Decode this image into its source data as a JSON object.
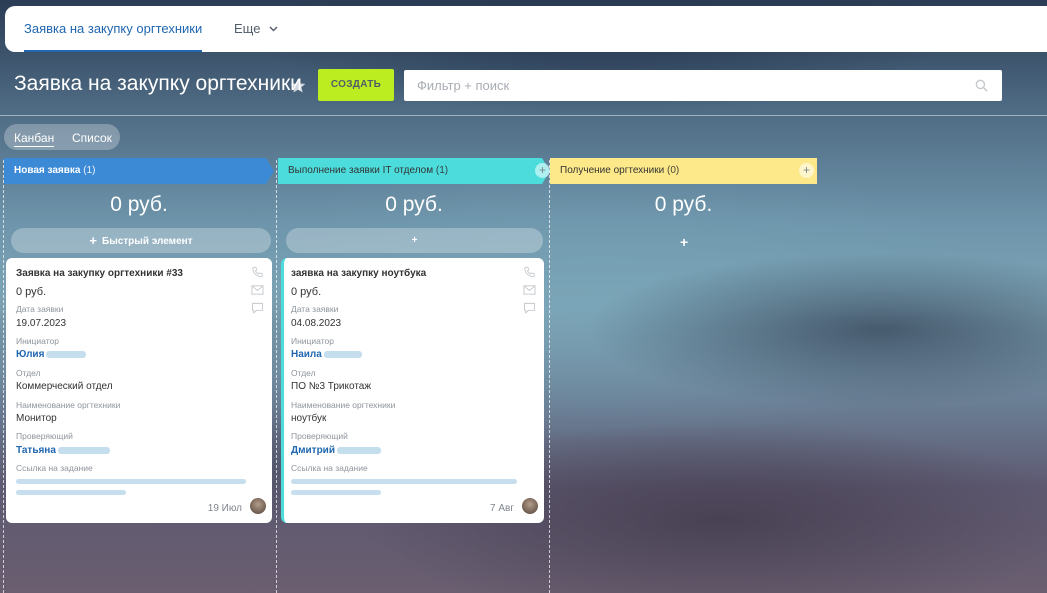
{
  "topbar": {
    "tab_active": "Заявка на закупку оргтехники",
    "tab_more": "Еще"
  },
  "header": {
    "title": "Заявка на закупку оргтехники",
    "create_label": "СОЗДАТЬ",
    "search_placeholder": "Фильтр + поиск"
  },
  "view_switch": {
    "kanban": "Канбан",
    "list": "Список"
  },
  "columns": [
    {
      "name": "Новая заявка",
      "count": "(1)",
      "sum": "0 руб.",
      "quick_add": "Быстрый элемент",
      "color": "#3c8ad6"
    },
    {
      "name": "Выполнение заявки IT отделом",
      "count": "(1)",
      "sum": "0 руб.",
      "quick_add": "+",
      "color": "#4cdcdc"
    },
    {
      "name": "Получение оргтехники",
      "count": "(0)",
      "sum": "0 руб.",
      "quick_add": "+",
      "color": "#fde989"
    }
  ],
  "cards": [
    {
      "title": "Заявка на закупку оргтехники #33",
      "sum": "0 руб.",
      "date_label": "Дата заявки",
      "date_value": "19.07.2023",
      "initiator_label": "Инициатор",
      "initiator_value": "Юлия",
      "dept_label": "Отдел",
      "dept_value": "Коммерческий отдел",
      "item_label": "Наименование оргтехники",
      "item_value": "Монитор",
      "reviewer_label": "Проверяющий",
      "reviewer_value": "Татьяна",
      "link_label": "Ссылка на задание",
      "footer_date": "19 Июл"
    },
    {
      "title": "заявка на закупку ноутбука",
      "sum": "0 руб.",
      "date_label": "Дата заявки",
      "date_value": "04.08.2023",
      "initiator_label": "Инициатор",
      "initiator_value": "Наила",
      "dept_label": "Отдел",
      "dept_value": "ПО №3 Трикотаж",
      "item_label": "Наименование оргтехники",
      "item_value": "ноутбук",
      "reviewer_label": "Проверяющий",
      "reviewer_value": "Дмитрий",
      "link_label": "Ссылка на задание",
      "footer_date": "7 Авг"
    }
  ],
  "icons": {
    "star": "star-icon",
    "search": "search-icon",
    "phone": "phone-icon",
    "mail": "mail-icon",
    "chat": "chat-icon",
    "chevron": "chevron-down-icon"
  },
  "colors": {
    "accent_blue": "#2067b0",
    "create_green": "#bbed21"
  }
}
